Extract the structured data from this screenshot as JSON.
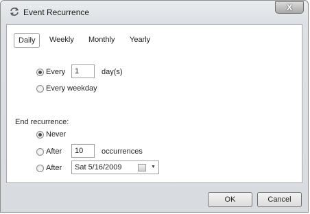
{
  "window": {
    "title": "Event Recurrence",
    "close_label": "X"
  },
  "tabs": [
    "Daily",
    "Weekly",
    "Monthly",
    "Yearly"
  ],
  "daily": {
    "every_label": "Every",
    "every_value": "1",
    "every_unit": "day(s)",
    "every_weekday_label": "Every weekday"
  },
  "end": {
    "heading": "End recurrence:",
    "never_label": "Never",
    "after_label": "After",
    "after_value": "10",
    "occurrences_label": "occurrences",
    "after_date_label": "After",
    "date_value": "Sat 5/16/2009"
  },
  "buttons": {
    "ok": "OK",
    "cancel": "Cancel"
  }
}
